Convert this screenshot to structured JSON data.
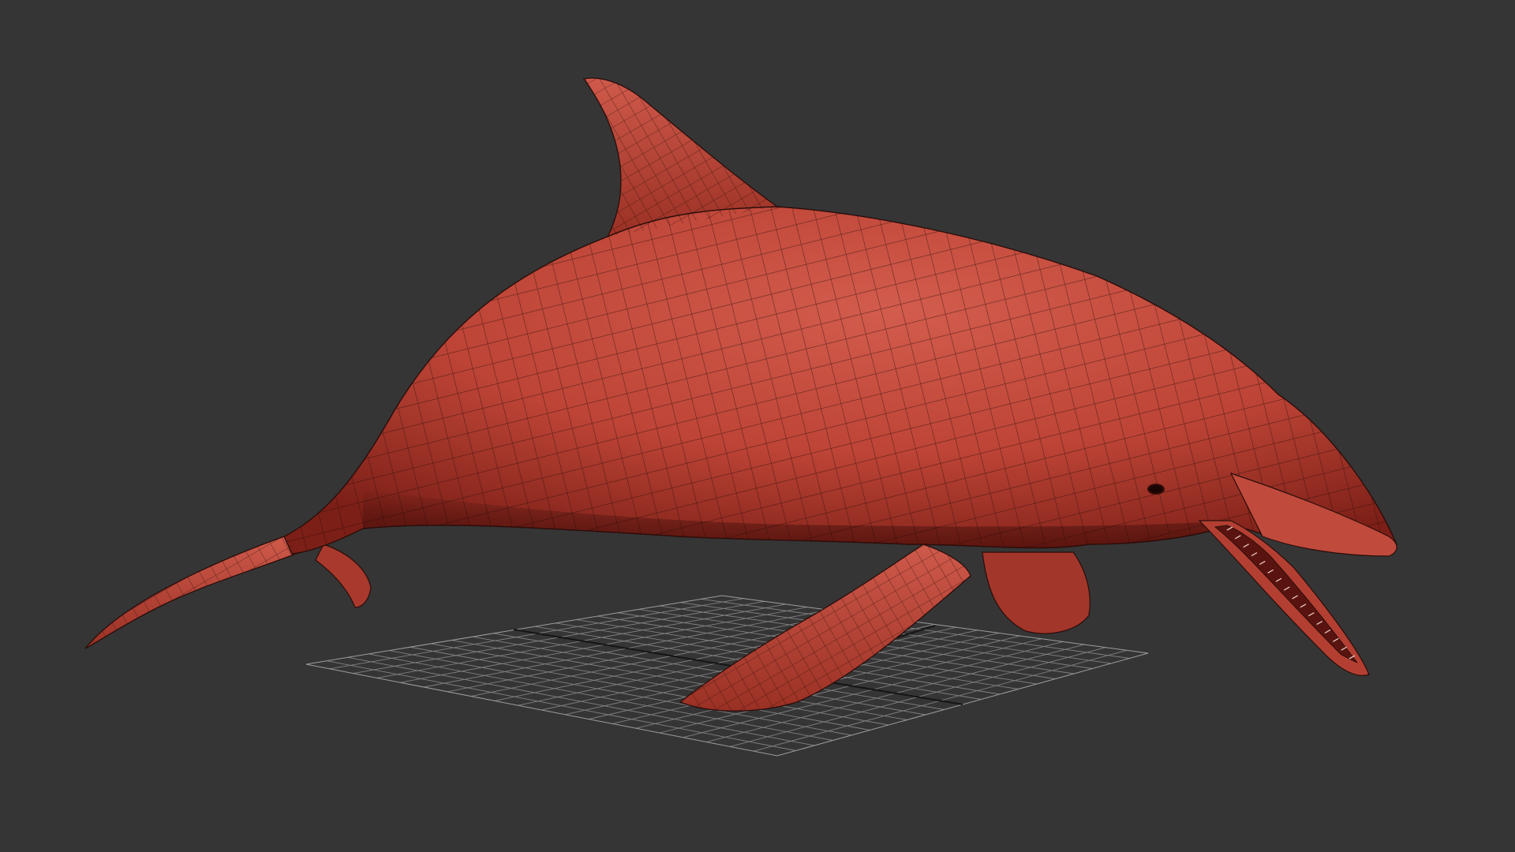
{
  "viewport": {
    "background_color": "#353535",
    "shading_mode": "shaded-with-wireframe"
  },
  "model": {
    "subject": "dolphin",
    "base_color": "#c0473a",
    "shadow_color": "#7a1f18",
    "highlight_color": "#d9685a",
    "wire_color": "#2a0d0a"
  },
  "ground_grid": {
    "visible": true,
    "line_color": "#a8a8a8",
    "axis_color": "#151515"
  }
}
